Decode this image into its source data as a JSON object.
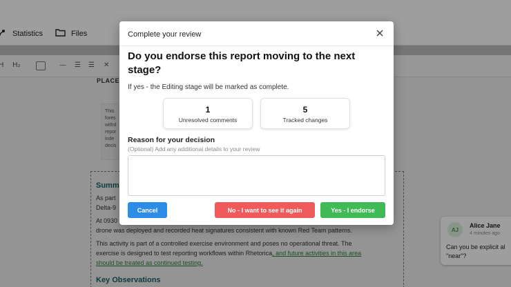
{
  "app": {
    "nav": {
      "statistics": "Statistics",
      "files": "Files"
    },
    "toolbar": {
      "heading_label": "H₂"
    },
    "document": {
      "placeholder": "PLACEH",
      "notice_lines": [
        "This",
        "fores",
        "withd",
        "repor",
        "inde",
        "decis"
      ],
      "summary_heading": "Summ",
      "lines": {
        "l1": "As part",
        "l2": "Delta-9",
        "l3": "At 0930",
        "l4": "drone was deployed and recorded heat signatures consistent with known Red Team patterns.",
        "l5": "This activity is part of a controlled exercise environment and poses no operational threat. The",
        "l6a": "exercise is designed to test reporting workflows within Rhetorica",
        "l6b": ", and future activities in this area",
        "l7": "should be treated as continued testing."
      },
      "key_observations": "Key Observations"
    },
    "comment": {
      "initials": "AJ",
      "author": "Alice Jane",
      "time": "4 minutes ago",
      "text_line1": "Can you be explicit al",
      "text_line2": "\"near\"?"
    }
  },
  "modal": {
    "title": "Complete your review",
    "question": "Do you endorse this report moving to the next stage?",
    "subtitle": "If yes - the Editing stage will be marked as complete.",
    "stats": [
      {
        "value": "1",
        "label": "Unresolved comments"
      },
      {
        "value": "5",
        "label": "Tracked changes"
      }
    ],
    "reason_label": "Reason for your decision",
    "reason_hint": "(Optional) Add any additional details to your review",
    "reason_value": "",
    "buttons": {
      "cancel": "Cancel",
      "no": "No - I want to see it again",
      "yes": "Yes - I endorse"
    }
  },
  "colors": {
    "cancel": "#2d8ce6",
    "no": "#f15a5a",
    "yes": "#3fba55",
    "heading_teal": "#1b5e64"
  },
  "icons": [
    "statistics-icon",
    "folder-icon",
    "close-icon"
  ]
}
